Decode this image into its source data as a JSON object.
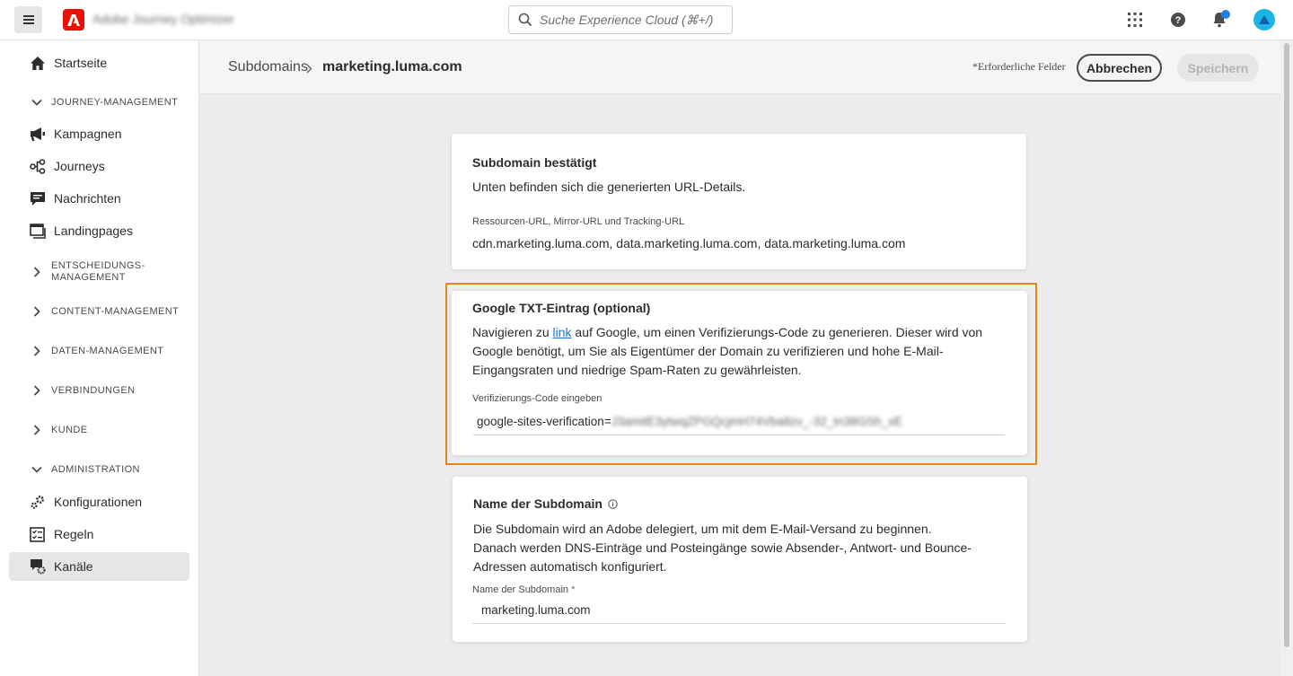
{
  "topbar": {
    "app_name": "Adobe Journey Optimizer",
    "search_placeholder": "Suche Experience Cloud (⌘+/)"
  },
  "sidebar": {
    "home": "Startseite",
    "group_journey": "JOURNEY-MANAGEMENT",
    "campaigns": "Kampagnen",
    "journeys": "Journeys",
    "messages": "Nachrichten",
    "landingpages": "Landingpages",
    "group_decision_line1": "ENTSCHEIDUNGS-",
    "group_decision_line2": "MANAGEMENT",
    "group_content": "CONTENT-MANAGEMENT",
    "group_data": "DATEN-MANAGEMENT",
    "group_connections": "VERBINDUNGEN",
    "group_customer": "KUNDE",
    "group_admin": "ADMINISTRATION",
    "configurations": "Konfigurationen",
    "rules": "Regeln",
    "channels": "Kanäle"
  },
  "header": {
    "crumb_parent": "Subdomains",
    "crumb_current": "marketing.luma.com",
    "required_note": "*Erforderliche Felder",
    "cancel_label": "Abbrechen",
    "save_label": "Speichern"
  },
  "card_confirmed": {
    "title": "Subdomain bestätigt",
    "text": "Unten befinden sich die generierten URL-Details.",
    "field_label": "Ressourcen-URL, Mirror-URL und Tracking-URL",
    "field_value": "cdn.marketing.luma.com, data.marketing.luma.com, data.marketing.luma.com"
  },
  "card_google": {
    "title": "Google TXT-Eintrag (optional)",
    "text_before_link": "Navigieren zu ",
    "link_text": "link",
    "text_after_link": " auf Google, um einen Verifizierungs-Code zu generieren. Dieser wird von Google benötigt, um Sie als Eigentümer der Domain zu verifizieren und hohe E-Mail-Eingangsraten und niedrige Spam-Raten zu gewährleisten.",
    "field_label": "Verifizierungs-Code eingeben",
    "value_prefix": "google-sites-verification=",
    "value_rest": "J3amitE3ytwqZPGQcjmH74Vba8zv_-32_tn38GSh_xE"
  },
  "card_name": {
    "title": "Name der Subdomain",
    "text": "Die Subdomain wird an Adobe delegiert, um mit dem E-Mail-Versand zu beginnen. Danach werden DNS-Einträge und Posteingänge sowie Absender-, Antwort- und Bounce-Adressen automatisch konfiguriert.",
    "field_label": "Name der Subdomain",
    "required_mark": "*",
    "field_value": "marketing.luma.com"
  },
  "colors": {
    "highlight": "#e68619",
    "adobe_red": "#eb1000",
    "link": "#1473e6"
  }
}
